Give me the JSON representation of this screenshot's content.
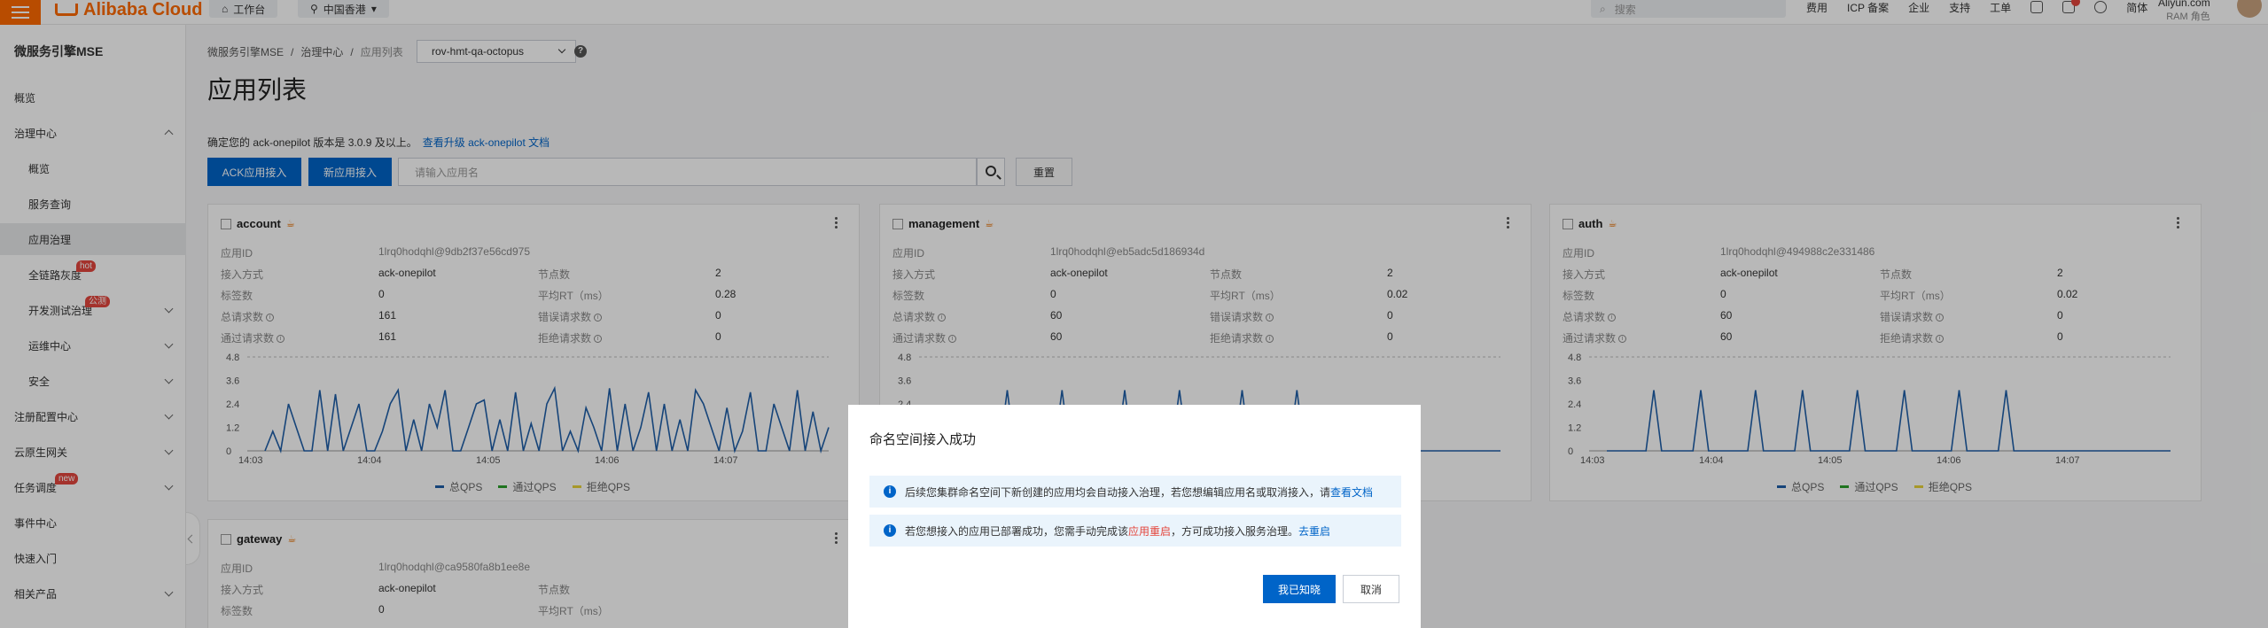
{
  "topbar": {
    "logo": "Alibaba Cloud",
    "workbench": "工作台",
    "region": "中国香港",
    "search_placeholder": "搜索",
    "links": [
      "费用",
      "ICP 备案",
      "企业",
      "支持",
      "工单"
    ],
    "lang": "简体",
    "account_name": "Aliyun.com",
    "account_role": "RAM 角色"
  },
  "sidebar": {
    "title": "微服务引擎MSE",
    "items": [
      {
        "label": "概览"
      },
      {
        "label": "治理中心"
      },
      {
        "label": "概览"
      },
      {
        "label": "服务查询"
      },
      {
        "label": "应用治理"
      },
      {
        "label": "全链路灰度",
        "tag": "hot"
      },
      {
        "label": "开发测试治理",
        "tag": "公测"
      },
      {
        "label": "运维中心"
      },
      {
        "label": "安全"
      },
      {
        "label": "注册配置中心"
      },
      {
        "label": "云原生网关"
      },
      {
        "label": "任务调度",
        "tag": "new"
      },
      {
        "label": "事件中心"
      },
      {
        "label": "快速入门"
      },
      {
        "label": "相关产品"
      }
    ]
  },
  "breadcrumb": [
    "微服务引擎MSE",
    "治理中心",
    "应用列表"
  ],
  "namespace": "rov-hmt-qa-octopus",
  "page_title": "应用列表",
  "notice": {
    "text": "确定您的 ack-onepilot 版本是 3.0.9 及以上。",
    "link": "查看升级 ack-onepilot 文档"
  },
  "actions": {
    "ack": "ACK应用接入",
    "new": "新应用接入",
    "search_placeholder": "请输入应用名",
    "reset": "重置"
  },
  "field_labels": {
    "app_id": "应用ID",
    "access": "接入方式",
    "nodes": "节点数",
    "tags": "标签数",
    "avg_rt": "平均RT（ms）",
    "total_req": "总请求数",
    "err_req": "错误请求数",
    "pass_req": "通过请求数",
    "reject_req": "拒绝请求数"
  },
  "legend": [
    "总QPS",
    "通过QPS",
    "拒绝QPS"
  ],
  "colors": {
    "total": "#1f5fa8",
    "pass": "#2ca02c",
    "reject": "#e8d33b",
    "primary": "#0064c8",
    "accent": "#ff6a00"
  },
  "apps": [
    {
      "name": "account",
      "app_id": "1lrq0hodqhl@9db2f37e56cd975",
      "access": "ack-onepilot",
      "nodes": "2",
      "tags": "0",
      "avg_rt": "0.28",
      "total_req": "161",
      "err_req": "0",
      "pass_req": "161",
      "reject_req": "0"
    },
    {
      "name": "management",
      "app_id": "1lrq0hodqhl@eb5adc5d186934d",
      "access": "ack-onepilot",
      "nodes": "2",
      "tags": "0",
      "avg_rt": "0.02",
      "total_req": "60",
      "err_req": "0",
      "pass_req": "60",
      "reject_req": "0"
    },
    {
      "name": "auth",
      "app_id": "1lrq0hodqhl@494988c2e331486",
      "access": "ack-onepilot",
      "nodes": "2",
      "tags": "0",
      "avg_rt": "0.02",
      "total_req": "60",
      "err_req": "0",
      "pass_req": "60",
      "reject_req": "0"
    },
    {
      "name": "gateway",
      "app_id": "1lrq0hodqhl@ca9580fa8b1ee8e",
      "access": "ack-onepilot",
      "nodes": "",
      "tags": "0",
      "avg_rt": "",
      "total_req": "",
      "err_req": "",
      "pass_req": "",
      "reject_req": ""
    }
  ],
  "chart_data": [
    {
      "type": "line",
      "app": "account",
      "yticks": [
        "4.8",
        "3.6",
        "2.4",
        "1.2",
        "0"
      ],
      "ylim": [
        0,
        4.8
      ],
      "xticks": [
        "14:03",
        "14:04",
        "14:05",
        "14:06",
        "14:07"
      ],
      "series": [
        {
          "name": "总QPS",
          "values": [
            0,
            1,
            0,
            2.4,
            1.2,
            0,
            0,
            3.1,
            0,
            2.9,
            0,
            1.2,
            2.4,
            0,
            0,
            1,
            2.4,
            3.1,
            0,
            1.6,
            0,
            2.4,
            1.2,
            3.1,
            0,
            0,
            1.2,
            2.4,
            2.6,
            0,
            1.6,
            0,
            3,
            0,
            1.4,
            0,
            2.4,
            3.2,
            0,
            1,
            0,
            2.2,
            1.2,
            0,
            3.2,
            0,
            2.4,
            0,
            1.2,
            3,
            0,
            2.4,
            0,
            1.6,
            0,
            3.1,
            2.4,
            1.2,
            0,
            2.2,
            0,
            1,
            3,
            0,
            0,
            2.4,
            1.2,
            0,
            3.1,
            0,
            2,
            0,
            1.2
          ]
        }
      ]
    },
    {
      "type": "line",
      "app": "management",
      "yticks": [
        "4.8",
        "3.6",
        "2.4",
        "1.2",
        "0"
      ],
      "ylim": [
        0,
        4.8
      ],
      "xticks": [
        "14:03",
        "14:04",
        "14:05",
        "14:06",
        "14:07"
      ],
      "series": [
        {
          "name": "总QPS",
          "values": [
            0,
            0,
            0,
            0,
            0,
            0,
            0,
            0,
            0,
            3.1,
            0,
            0,
            0,
            0,
            0,
            0,
            3.1,
            0,
            0,
            0,
            0,
            0,
            0,
            0,
            3.1,
            0,
            0,
            0,
            0,
            0,
            0,
            3.1,
            0,
            0,
            0,
            0,
            0,
            0,
            0,
            3.1,
            0,
            0,
            0,
            0,
            0,
            0,
            3.1,
            0,
            0,
            0,
            0,
            0,
            0,
            0,
            0,
            0,
            0,
            0,
            0,
            0,
            0,
            0,
            0,
            0,
            0,
            0,
            0,
            0,
            0,
            0,
            0,
            0,
            0
          ]
        }
      ]
    },
    {
      "type": "line",
      "app": "auth",
      "yticks": [
        "4.8",
        "3.6",
        "2.4",
        "1.2",
        "0"
      ],
      "ylim": [
        0,
        4.8
      ],
      "xticks": [
        "14:03",
        "14:04",
        "14:05",
        "14:06",
        "14:07"
      ],
      "series": [
        {
          "name": "总QPS",
          "values": [
            0,
            0,
            0,
            0,
            0,
            0,
            3.1,
            0,
            0,
            0,
            0,
            0,
            3.1,
            0,
            0,
            0,
            0,
            0,
            0,
            3.1,
            0,
            0,
            0,
            0,
            0,
            3.1,
            0,
            0,
            0,
            0,
            0,
            0,
            3.1,
            0,
            0,
            0,
            0,
            0,
            3.1,
            0,
            0,
            0,
            0,
            0,
            0,
            3.1,
            0,
            0,
            0,
            0,
            0,
            3.1,
            0,
            0,
            0,
            0,
            0,
            0,
            0,
            0,
            0,
            0,
            0,
            0,
            0,
            0,
            0,
            0,
            0,
            0,
            0,
            0,
            0
          ]
        }
      ]
    }
  ],
  "dialog": {
    "title": "命名空间接入成功",
    "msg1": "后续您集群命名空间下新创建的应用均会自动接入治理，若您想编辑应用名或取消接入，请",
    "msg1_link": "查看文档",
    "msg2_a": "若您想接入的应用已部署成功，您需手动完成该",
    "msg2_red": "应用重启",
    "msg2_b": "，方可成功接入服务治理。",
    "msg2_link": "去重启",
    "ok": "我已知晓",
    "cancel": "取消"
  }
}
